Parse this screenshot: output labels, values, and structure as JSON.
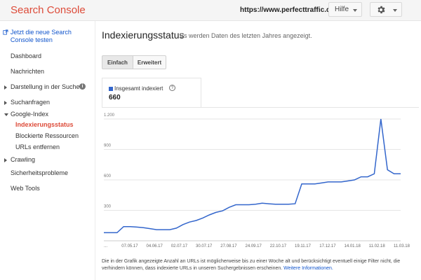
{
  "header": {
    "brand": "Search Console",
    "site_url": "https://www.perfecttraffic.de/",
    "help_label": "Hilfe"
  },
  "sidebar": {
    "new_console_link": "Jetzt die neue Search Console testen",
    "items": {
      "dashboard": "Dashboard",
      "messages": "Nachrichten",
      "appearance": "Darstellung in der Suche",
      "search_traffic": "Suchanfragen",
      "google_index": "Google-Index",
      "index_status": "Indexierungsstatus",
      "blocked_resources": "Blockierte Ressourcen",
      "remove_urls": "URLs entfernen",
      "crawling": "Crawling",
      "security": "Sicherheitsprobleme",
      "web_tools": "Web Tools"
    }
  },
  "main": {
    "title": "Indexierungsstatus",
    "subtitle": "Es werden Daten des letzten Jahres angezeigt.",
    "tabs": {
      "simple": "Einfach",
      "advanced": "Erweitert"
    },
    "legend": {
      "label": "Insgesamt indexiert",
      "value": "660",
      "help": "?"
    },
    "footer_text": "Die in der Grafik angezeigte Anzahl an URLs ist möglicherweise bis zu einer Woche alt und berücksichtigt eventuell einige Filter nicht, die verhindern können, dass indexierte URLs in unseren Suchergebnissen erscheinen.",
    "footer_link": "Weitere Informationen."
  },
  "colors": {
    "accent": "#dd4b39",
    "series": "#3366cc",
    "link": "#1155cc"
  },
  "chart_data": {
    "type": "line",
    "series": [
      {
        "name": "Insgesamt indexiert",
        "values": [
          80,
          80,
          80,
          140,
          140,
          135,
          130,
          120,
          110,
          110,
          110,
          125,
          160,
          185,
          200,
          225,
          255,
          280,
          295,
          330,
          355,
          355,
          355,
          360,
          370,
          365,
          360,
          360,
          360,
          365,
          560,
          560,
          560,
          570,
          580,
          580,
          580,
          590,
          600,
          630,
          630,
          660,
          1200,
          700,
          660,
          660
        ]
      }
    ],
    "x_tick_labels": [
      "...",
      "07.05.17",
      "04.06.17",
      "02.07.17",
      "30.07.17",
      "27.08.17",
      "24.09.17",
      "22.10.17",
      "19.11.17",
      "17.12.17",
      "14.01.18",
      "11.02.18",
      "11.03.18"
    ],
    "y_tick_labels": [
      "300",
      "600",
      "900",
      "1.200"
    ],
    "y_ticks": [
      300,
      600,
      900,
      1200
    ],
    "ylim": [
      0,
      1200
    ],
    "grid": true
  }
}
